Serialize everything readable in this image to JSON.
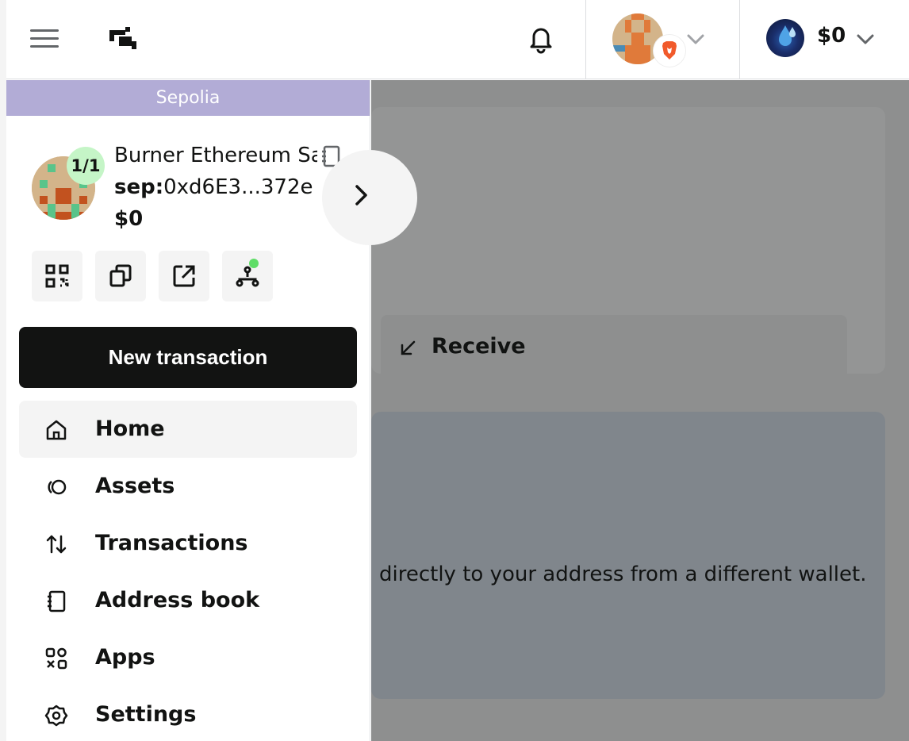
{
  "header": {
    "balance": "$0"
  },
  "sidebar": {
    "network": "Sepolia",
    "safe": {
      "threshold": "1/1",
      "name": "Burner Ethereum Sa",
      "address_prefix": "sep:",
      "address": "0xd6E3...372e",
      "balance": "$0"
    },
    "new_transaction": "New transaction",
    "nav": [
      {
        "label": "Home",
        "icon": "home-icon",
        "active": true
      },
      {
        "label": "Assets",
        "icon": "assets-icon"
      },
      {
        "label": "Transactions",
        "icon": "transactions-icon"
      },
      {
        "label": "Address book",
        "icon": "address-book-icon"
      },
      {
        "label": "Apps",
        "icon": "apps-icon"
      },
      {
        "label": "Settings",
        "icon": "settings-icon"
      }
    ]
  },
  "main": {
    "receive_label": "Receive",
    "card_text": "directly to your address from a different wallet."
  },
  "colors": {
    "network_bar": "#b2acd6",
    "threshold_badge": "#c5f5c7",
    "primary_button": "#121312",
    "active_dot": "#5fdd67"
  }
}
